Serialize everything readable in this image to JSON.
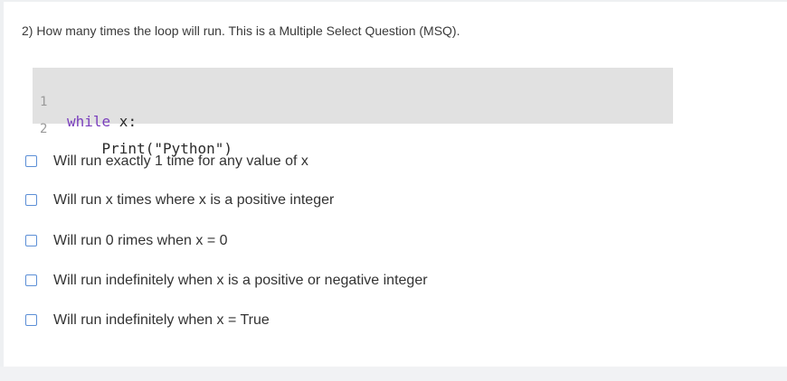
{
  "question": {
    "text": "2) How many times the loop will run. This is a Multiple Select Question (MSQ)."
  },
  "code": {
    "lines": [
      {
        "number": "1",
        "keyword": "while",
        "rest": " x:"
      },
      {
        "number": "2",
        "text": "    Print(\"Python\")"
      }
    ]
  },
  "options": [
    {
      "label": "Will run exactly 1 time for any value of x",
      "checked": false
    },
    {
      "label": "Will run x times where x is a positive integer",
      "checked": false
    },
    {
      "label": "Will run 0 rimes when x = 0",
      "checked": false
    },
    {
      "label": "Will run indefinitely when x is a positive or negative integer",
      "checked": false
    },
    {
      "label": "Will run indefinitely when x = True",
      "checked": false
    }
  ],
  "colors": {
    "checkbox_border": "#5c8fd6",
    "code_background": "#e1e1e1",
    "keyword": "#7a3fbd"
  }
}
